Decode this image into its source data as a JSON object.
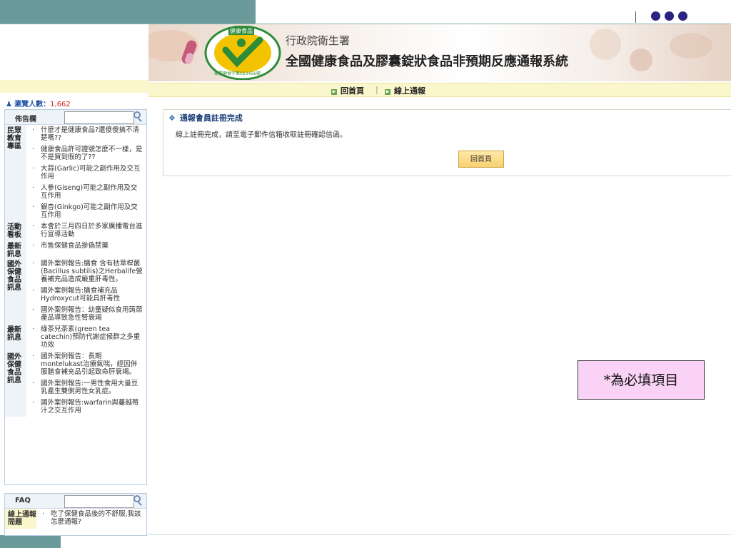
{
  "slide": {
    "accent_teal": "#6b9a9a",
    "dot_color": "#2a2382",
    "note": "*為必填項目"
  },
  "banner": {
    "agency": "行政院衛生署",
    "system_title": "全國健康食品及膠囊錠狀食品非預期反應通報系統",
    "logo_text": "健康食品",
    "logo_number": "衛署健食字第023456號"
  },
  "nav": {
    "items": [
      "回首頁",
      "線上通報"
    ],
    "separator": "|"
  },
  "visitor": {
    "label": "瀏覽人數：",
    "count": "1,662"
  },
  "bulletin": {
    "title": "佈告欄",
    "categories": [
      {
        "label": "民眾教育專區",
        "items": [
          "什麼才是健康食品?還傻傻搞不清楚嗎??",
          "健康食品許可證號怎麼不一樣，是不是買到假的了??",
          "大蒜(Garlic)可能之副作用及交互作用",
          "人參(Giseng)可能之副作用及交互作用",
          "銀杏(Ginkgo)可能之副作用及交互作用"
        ]
      },
      {
        "label": "活動看板",
        "items": [
          "本會於三月四日於多家廣播電台進行宣導活動"
        ]
      },
      {
        "label": "最新訊息",
        "items": [
          "市售保健食品摻偽禁藥"
        ]
      },
      {
        "label": "國外保健食品訊息",
        "items": [
          "國外案例報告:膳食 含有枯草桿菌(Bacillus subtilis)之Herbalife營養補充品造成嚴重肝毒性。",
          "國外案例報告:膳食補充品Hydroxycut可能具肝毒性",
          "國外案例報告：幼童疑似食用蒟蒻產品導致急性腎衰竭"
        ]
      },
      {
        "label": "最新訊息",
        "items": [
          "綠茶兒茶素(green tea catechin)預防代謝症候群之多重功效"
        ]
      },
      {
        "label": "國外保健食品訊息",
        "items": [
          "國外案例報告：長期montelukast治療氣喘，經因併服膳食補充品引起致命肝衰竭。",
          "國外案例報告:一男性食用大量豆乳產生雙側男性女乳症。",
          "國外案例報告:warfarin與蔓越莓汁之交互作用"
        ]
      }
    ]
  },
  "faq": {
    "title": "FAQ",
    "categories": [
      {
        "label": "線上通報問題",
        "items": [
          "吃了保健食品後的不舒服,我該怎麼通報?"
        ]
      }
    ]
  },
  "main": {
    "title": "通報會員註冊完成",
    "message": "線上註冊完成，請至電子郵件信箱收取註冊確認信函。",
    "button": "回首頁"
  }
}
